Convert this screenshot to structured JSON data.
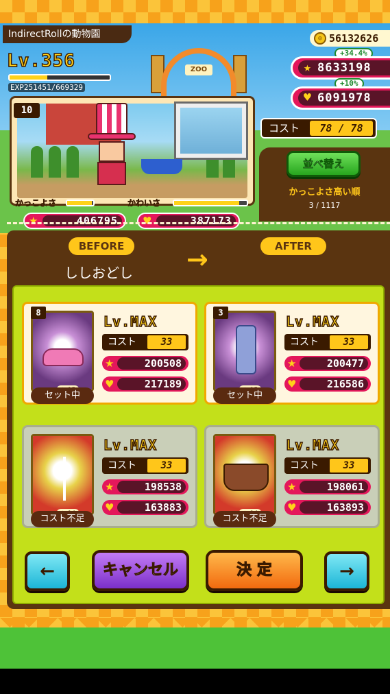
{
  "header": {
    "zoo_name": "IndirectRollの動物園",
    "level": "Lv.356",
    "exp_text": "EXP251451/669329",
    "exp_progress": 0.38,
    "coins": "56132626",
    "coolness_total": "8633198",
    "coolness_bonus": "+34.4%",
    "cuteness_total": "6091978",
    "cuteness_bonus": "+10%",
    "gate_label": "ZOO"
  },
  "character": {
    "number": "10",
    "coolness_label": "かっこよさ",
    "cuteness_label": "かわいさ",
    "coolness_progress": 0.95,
    "cuteness_progress": 0.9,
    "coolness_value": "406795",
    "cuteness_value": "387173"
  },
  "cost": {
    "label": "コスト",
    "value": "78 / 78"
  },
  "sort": {
    "button_label": "並べ替え",
    "order_label": "かっこよさ高い順",
    "count": "3 / 1117"
  },
  "dialog": {
    "before_label": "BEFORE",
    "after_label": "AFTER",
    "skill_name": "ししおどし",
    "arrow": "→"
  },
  "cards": [
    {
      "number": "8",
      "level": "Lv.MAX",
      "cost_label": "コスト",
      "cost": "33",
      "coolness": "200508",
      "cuteness": "217189",
      "item_level": "15",
      "status": "セット中",
      "item": "pink-car",
      "available": true
    },
    {
      "number": "3",
      "level": "Lv.MAX",
      "cost_label": "コスト",
      "cost": "33",
      "coolness": "200477",
      "cuteness": "216586",
      "item_level": "15",
      "status": "セット中",
      "item": "cell-phone",
      "available": true
    },
    {
      "number": "",
      "level": "Lv.MAX",
      "cost_label": "コスト",
      "cost": "33",
      "coolness": "198538",
      "cuteness": "163883",
      "item_level": "14",
      "status": "コスト不足",
      "item": "wind-turbine",
      "available": false
    },
    {
      "number": "",
      "level": "Lv.MAX",
      "cost_label": "コスト",
      "cost": "33",
      "coolness": "198061",
      "cuteness": "163893",
      "item_level": "14",
      "status": "コスト不足",
      "item": "pirate-ship",
      "available": false
    }
  ],
  "buttons": {
    "prev": "←",
    "cancel": "キャンセル",
    "confirm": "決 定",
    "next": "→"
  },
  "icons": {
    "star": "★",
    "heart": "♥"
  },
  "colors": {
    "brown": "#5a3410",
    "pink": "#e4175b",
    "gold": "#ffc61a",
    "lime": "#c3e01a"
  }
}
